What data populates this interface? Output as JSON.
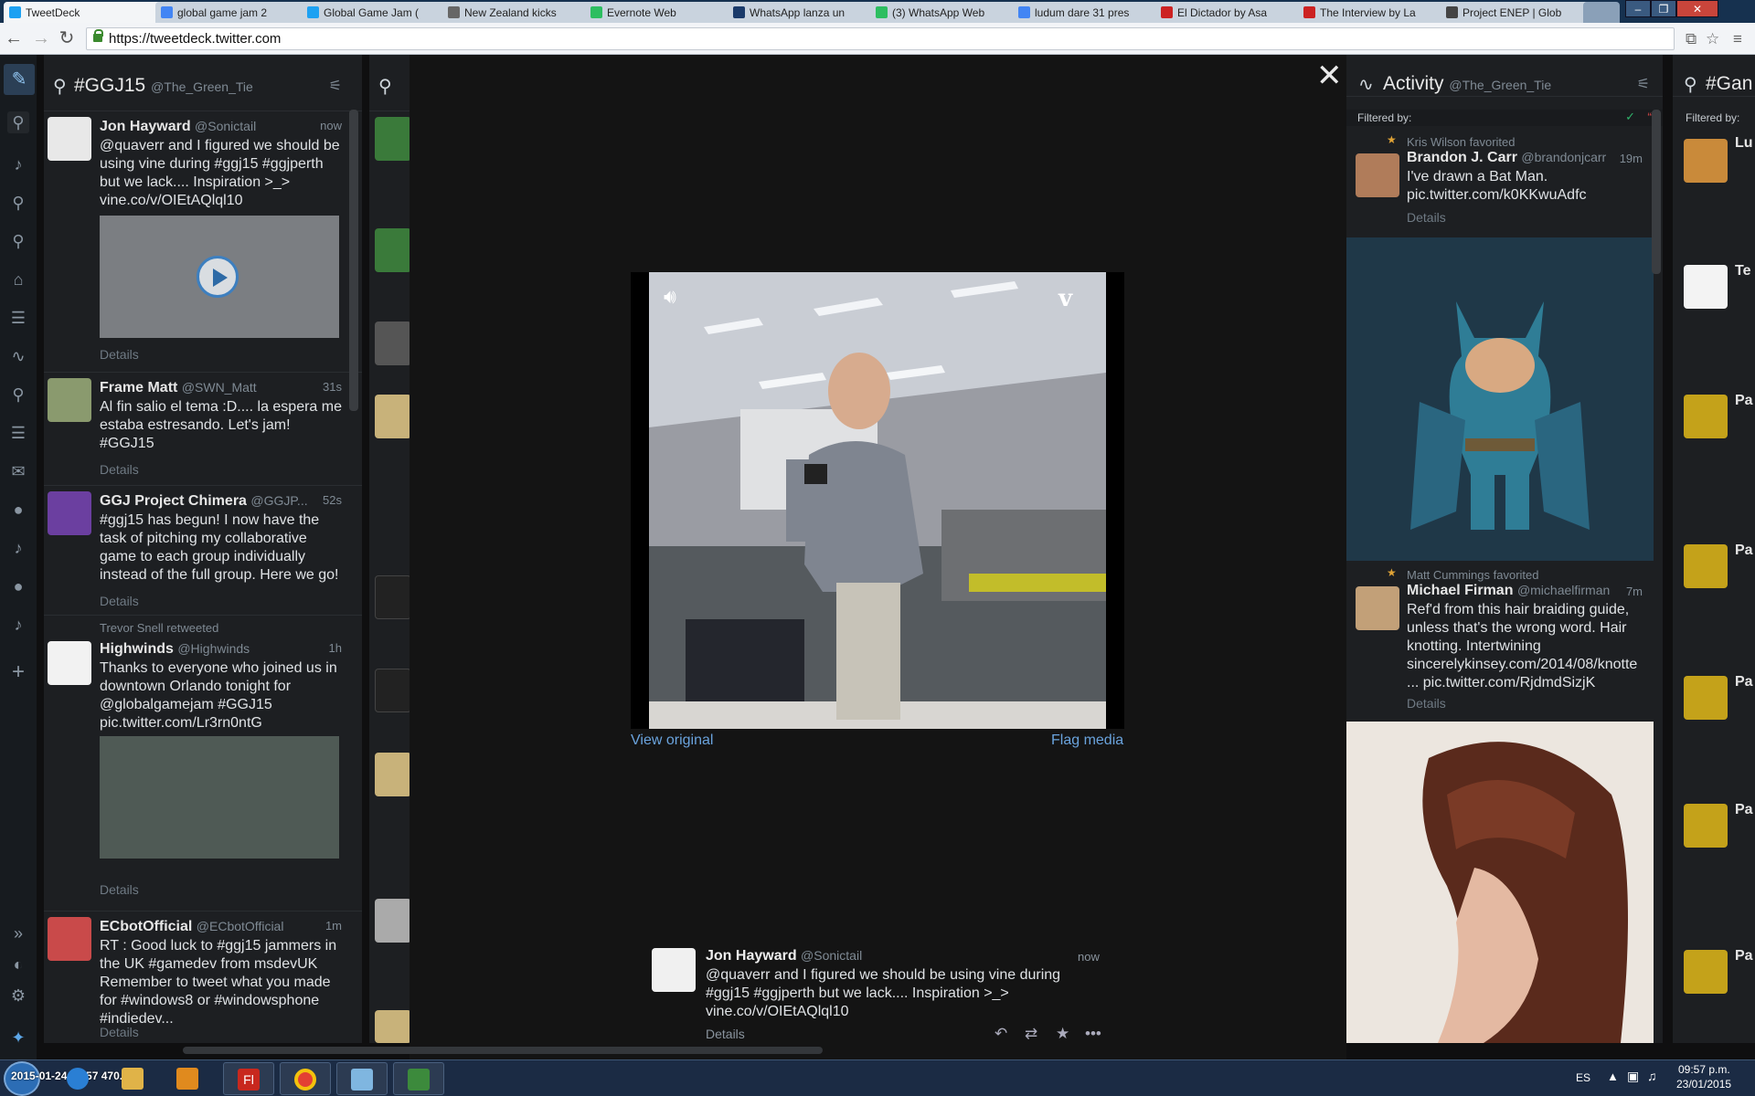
{
  "browser": {
    "tabs": [
      {
        "label": "TweetDeck",
        "favicon_color": "#1da1f2",
        "active": true
      },
      {
        "label": "global game jam 2",
        "favicon_color": "#4285f4"
      },
      {
        "label": "Global Game Jam (",
        "favicon_color": "#1da1f2"
      },
      {
        "label": "New Zealand kicks",
        "favicon_color": "#666666"
      },
      {
        "label": "Evernote Web",
        "favicon_color": "#2dbe60"
      },
      {
        "label": "WhatsApp lanza un",
        "favicon_color": "#1a3a6a"
      },
      {
        "label": "(3) WhatsApp Web",
        "favicon_color": "#2dbe60"
      },
      {
        "label": "ludum dare 31 pres",
        "favicon_color": "#4285f4"
      },
      {
        "label": "El Dictador by Asa",
        "favicon_color": "#cc2222"
      },
      {
        "label": "The Interview by La",
        "favicon_color": "#cc2222"
      },
      {
        "label": "Project ENEP | Glob",
        "favicon_color": "#444444"
      }
    ],
    "url": "https://tweetdeck.twitter.com"
  },
  "columns": {
    "search": {
      "title": "#GGJ15",
      "user": "@The_Green_Tie",
      "tweets": [
        {
          "name": "Jon Hayward",
          "handle": "@Sonictail",
          "time": "now",
          "pre": "",
          "body": "@quaverr and I figured we should be using vine during #ggj15 #ggjperth but we lack.... Inspiration >_> vine.co/v/OIEtAQlql10",
          "details": "Details"
        },
        {
          "name": "Frame Matt",
          "handle": "@SWN_Matt",
          "time": "31s",
          "pre": "",
          "body": "Al fin salio el tema :D.... la espera me estaba estresando. Let's jam! #GGJ15",
          "details": "Details"
        },
        {
          "name": "GGJ Project Chimera",
          "handle": "@GGJP...",
          "time": "52s",
          "pre": "",
          "body": "#ggj15 has begun! I now have the task of pitching my collaborative game to each group individually instead of the full group. Here we go!",
          "details": "Details"
        },
        {
          "name": "Highwinds",
          "handle": "@Highwinds",
          "time": "1h",
          "pre": "Trevor Snell retweeted",
          "body": "Thanks to everyone who joined us in downtown Orlando tonight for @globalgamejam #GGJ15 pic.twitter.com/Lr3rn0ntG",
          "details": "Details"
        },
        {
          "name": "ECbotOfficial",
          "handle": "@ECbotOfficial",
          "time": "1m",
          "pre": "",
          "body": "RT : Good luck to #ggj15 jammers in the UK #gamedev from msdevUK Remember to tweet what you made for #windows8 or #windowsphone #indiedev...",
          "details": "Details"
        }
      ]
    },
    "activity": {
      "title": "Activity",
      "user": "@The_Green_Tie",
      "filter": "Filtered by:",
      "items": [
        {
          "pre": "Kris Wilson favorited",
          "name": "Brandon J. Carr",
          "handle": "@brandonjcarr",
          "time": "19m",
          "body": "I've drawn a Bat Man. pic.twitter.com/k0KKwuAdfc",
          "details": "Details"
        },
        {
          "pre": "Matt Cummings favorited",
          "name": "Michael Firman",
          "handle": "@michaelfirman",
          "time": "7m",
          "body": "Ref'd from this hair braiding guide, unless that's the wrong word. Hair knotting. Intertwining sincerelykinsey.com/2014/08/knotte ... pic.twitter.com/RjdmdSizjK",
          "details": "Details"
        }
      ]
    },
    "game": {
      "title": "#Gan",
      "filter": "Filtered by:",
      "snippets": [
        "Lu",
        "Te",
        "Pa",
        "Pa",
        "Pa",
        "Pa",
        "Pa"
      ]
    }
  },
  "modal": {
    "view_original": "View original",
    "flag_media": "Flag media",
    "tweet": {
      "name": "Jon Hayward",
      "handle": "@Sonictail",
      "time": "now",
      "body": "@quaverr and I figured we should be using vine during #ggj15 #ggjperth but we lack.... Inspiration >_> vine.co/v/OIEtAQlql10",
      "details": "Details"
    }
  },
  "taskbar": {
    "lang": "ES",
    "time": "09:57 p.m.",
    "date": "23/01/2015",
    "overlay_text": "2015-01-24 21:57  470.08"
  },
  "colors": {
    "accent": "#5f9ed8",
    "column_bg": "#1d1f22",
    "overlay_bg": "#141414"
  }
}
